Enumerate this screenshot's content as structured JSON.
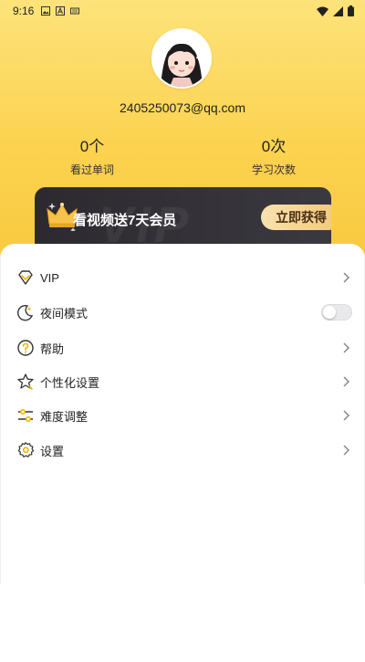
{
  "status_bar": {
    "time": "9:16",
    "left_icons": [
      "image-icon",
      "font-icon",
      "keyboard-icon"
    ],
    "right_icons": [
      "wifi-icon",
      "signal-icon",
      "battery-icon"
    ]
  },
  "profile": {
    "email": "2405250073@qq.com",
    "stats": [
      {
        "value": "0个",
        "label": "看过单词"
      },
      {
        "value": "0次",
        "label": "学习次数"
      }
    ]
  },
  "vip_banner": {
    "watermark": "VIP",
    "text": "看视频送7天会员",
    "button_label": "立即获得"
  },
  "menu": {
    "items": [
      {
        "label": "VIP",
        "icon": "vip-diamond-icon",
        "control": "chevron"
      },
      {
        "label": "夜间模式",
        "icon": "moon-icon",
        "control": "toggle",
        "toggle_on": false
      },
      {
        "label": "帮助",
        "icon": "help-icon",
        "control": "chevron"
      },
      {
        "label": "个性化设置",
        "icon": "star-icon",
        "control": "chevron"
      },
      {
        "label": "难度调整",
        "icon": "sliders-icon",
        "control": "chevron"
      },
      {
        "label": "设置",
        "icon": "gear-icon",
        "control": "chevron"
      }
    ]
  },
  "colors": {
    "header_top": "#fde37a",
    "header_bottom": "#f8c83e",
    "vip_card": "#2c2a2f",
    "vip_button": "#f2c77c",
    "icon_accent": "#f5b400"
  }
}
